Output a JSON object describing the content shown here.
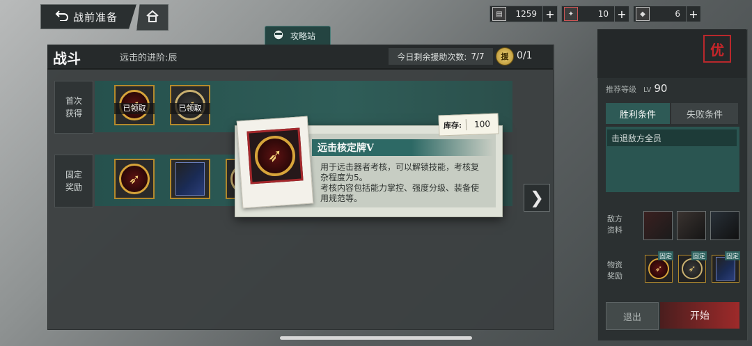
{
  "topbar": {
    "back_label": "战前准备",
    "resources": [
      {
        "icon": "ticket-icon",
        "value": "1259"
      },
      {
        "icon": "token-icon",
        "value": "10"
      },
      {
        "icon": "gem-icon",
        "value": "6"
      }
    ]
  },
  "guide_tab": {
    "label": "攻略站"
  },
  "battle": {
    "title": "战斗",
    "stage_name": "远击的进阶:辰",
    "assist_label": "今日剩余援助次数:",
    "assist_count": "7/7",
    "assist_coin_glyph": "援",
    "assist_value": "0/1"
  },
  "rows": {
    "first_label": [
      "首次",
      "获得"
    ],
    "fixed_label": [
      "固定",
      "奖励"
    ],
    "claimed_text": "已领取"
  },
  "right_panel": {
    "seal": "优",
    "recommend_label": "推荐等级",
    "lv_prefix": "LV",
    "level": "90",
    "win_tab": "胜利条件",
    "lose_tab": "失败条件",
    "win_condition": "击退敌方全员",
    "enemy_label": [
      "敌方",
      "资料"
    ],
    "supply_label": [
      "物资",
      "奖励"
    ],
    "fixed_tag": "固定",
    "retreat": "退出",
    "start": "开始"
  },
  "popup": {
    "stock_label": "库存:",
    "stock_value": "100",
    "item_name": "远击核定牌V",
    "desc_lines": [
      "用于远击器者考核，可以解锁技能，考核复",
      "杂程度为5。",
      "考核内容包括能力掌控、强度分级、装备使",
      "用规范等。"
    ]
  },
  "colors": {
    "accent_teal": "#2d6965",
    "start_red": "#9e2a2a",
    "gold": "#b48a2c"
  }
}
